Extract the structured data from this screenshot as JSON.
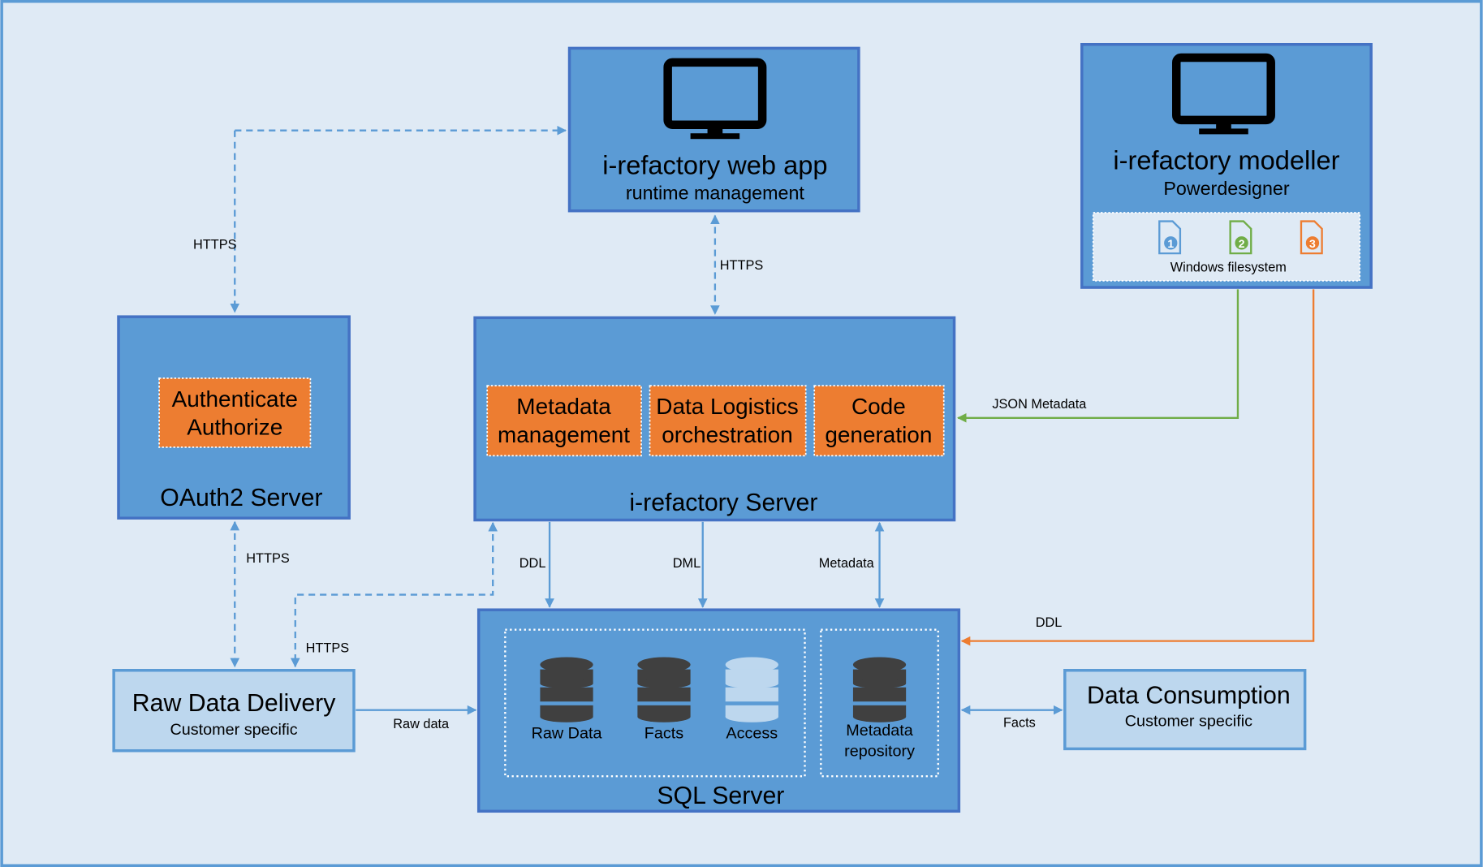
{
  "colors": {
    "background": "#dfeaf5",
    "box": "#5b9bd5",
    "box_border": "#4472c4",
    "light_box": "#bdd7ee",
    "orange": "#ed7d31",
    "green": "#70ad47",
    "db_dark": "#404040"
  },
  "web_app": {
    "title": "i-refactory web app",
    "subtitle": "runtime management",
    "icon": "monitor-icon"
  },
  "modeller": {
    "title": "i-refactory modeller",
    "subtitle": "Powerdesigner",
    "icon": "monitor-icon",
    "filesystem_label": "Windows filesystem",
    "files": [
      "1",
      "2",
      "3"
    ]
  },
  "oauth": {
    "title": "OAuth2 Server",
    "component_line1": "Authenticate",
    "component_line2": "Authorize"
  },
  "server": {
    "title": "i-refactory Server",
    "components": [
      {
        "line1": "Metadata",
        "line2": "management"
      },
      {
        "line1": "Data Logistics",
        "line2": "orchestration"
      },
      {
        "line1": "Code",
        "line2": "generation"
      }
    ]
  },
  "sql": {
    "title": "SQL Server",
    "databases": [
      "Raw Data",
      "Facts",
      "Access"
    ],
    "repo_line1": "Metadata",
    "repo_line2": "repository"
  },
  "raw_delivery": {
    "title": "Raw Data Delivery",
    "subtitle": "Customer specific"
  },
  "consumption": {
    "title": "Data Consumption",
    "subtitle": "Customer specific"
  },
  "connections": {
    "https_oauth_web": "HTTPS",
    "https_web_server": "HTTPS",
    "https_oauth_raw": "HTTPS",
    "https_server_raw": "HTTPS",
    "ddl": "DDL",
    "dml": "DML",
    "metadata": "Metadata",
    "json_metadata": "JSON Metadata",
    "ddl_modeller": "DDL",
    "raw_data": "Raw data",
    "facts": "Facts"
  }
}
